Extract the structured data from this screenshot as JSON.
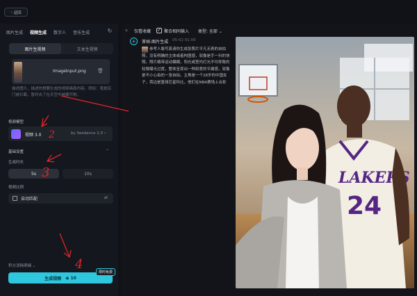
{
  "header": {
    "back_label": "返回"
  },
  "tabs": [
    {
      "label": "图片生成"
    },
    {
      "label": "视频生成"
    },
    {
      "label": "数字人"
    },
    {
      "label": "音乐生成"
    }
  ],
  "mode_tabs": [
    "图片生视频",
    "文本生视频"
  ],
  "upload": {
    "filename": "ImageInput.png"
  },
  "prompt": {
    "text": "描述图片，描述你想要生成的视频画面内容。例如：我是后门被拦截，暂时去了在天空中被藏开刷。"
  },
  "model_section": {
    "title": "视频模型",
    "name": "视频 3.0",
    "provider": "by Seedance 1.0"
  },
  "basic_section": {
    "title": "基础设置"
  },
  "duration": {
    "label": "生成时长",
    "options": [
      "5s",
      "10s"
    ],
    "selected": "5s"
  },
  "ratio": {
    "label": "视频比例",
    "value": "自动匹配"
  },
  "footer": {
    "credits_label": "积分消耗明细",
    "generate_label": "生成视频",
    "cost": "10",
    "badge": "限时免费"
  },
  "filters": {
    "favorite": "仅看收藏",
    "merge": "聚合相同输入",
    "type": "类型: 全部"
  },
  "entry": {
    "title": "首帧-图片生成",
    "time": "05-02 01:00",
    "description": "参考人像写真请你生成张照片平凡无奇的自拍照，没有明确的主体或者构图感，就像是手一抖的快照。照片略带运动模糊，阳光或室内灯光不均导致的轻微曝光过度，整体呈现出一种刻意的平庸感，就像是不小心拍的一张自拍。主角是一个28岁的中国女子，旁边是篮球巨星科比，他们在NBA赛场上合影"
  },
  "annotations": [
    "2",
    "3",
    "4"
  ],
  "colors": {
    "accent": "#2ec7de",
    "annotation": "#e0242c"
  }
}
